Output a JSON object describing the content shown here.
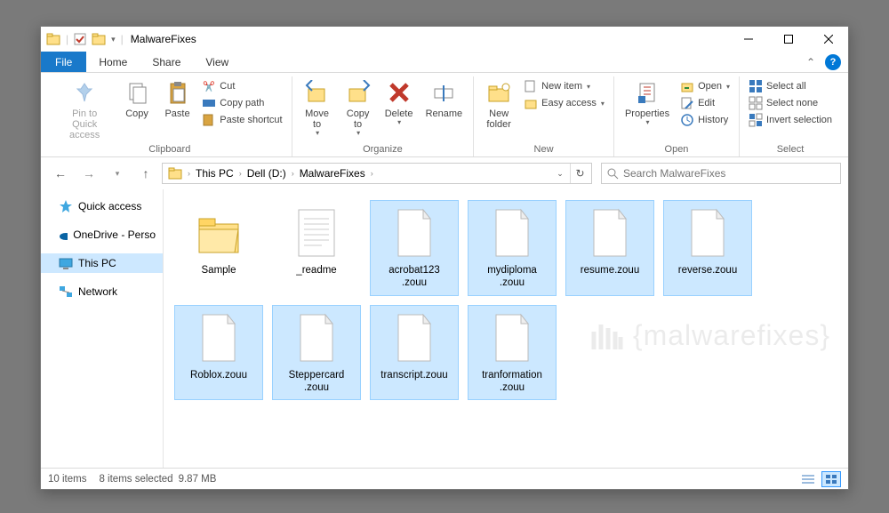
{
  "title": "MalwareFixes",
  "tabs": {
    "file": "File",
    "home": "Home",
    "share": "Share",
    "view": "View"
  },
  "ribbon": {
    "clipboard": {
      "label": "Clipboard",
      "pin": "Pin to Quick\naccess",
      "copy": "Copy",
      "paste": "Paste",
      "cut": "Cut",
      "copy_path": "Copy path",
      "paste_shortcut": "Paste shortcut"
    },
    "organize": {
      "label": "Organize",
      "move_to": "Move\nto",
      "copy_to": "Copy\nto",
      "delete": "Delete",
      "rename": "Rename"
    },
    "new": {
      "label": "New",
      "new_folder": "New\nfolder",
      "new_item": "New item",
      "easy_access": "Easy access"
    },
    "open": {
      "label": "Open",
      "properties": "Properties",
      "open": "Open",
      "edit": "Edit",
      "history": "History"
    },
    "select": {
      "label": "Select",
      "select_all": "Select all",
      "select_none": "Select none",
      "invert": "Invert selection"
    }
  },
  "breadcrumb": [
    "This PC",
    "Dell (D:)",
    "MalwareFixes"
  ],
  "search_placeholder": "Search MalwareFixes",
  "sidebar": {
    "quick_access": "Quick access",
    "onedrive": "OneDrive - Perso",
    "this_pc": "This PC",
    "network": "Network"
  },
  "files": [
    {
      "name": "Sample",
      "type": "folder",
      "selected": false
    },
    {
      "name": "_readme",
      "type": "text",
      "selected": false
    },
    {
      "name": "acrobat123\n.zouu",
      "type": "blank",
      "selected": true
    },
    {
      "name": "mydiploma\n.zouu",
      "type": "blank",
      "selected": true
    },
    {
      "name": "resume.zouu",
      "type": "blank",
      "selected": true
    },
    {
      "name": "reverse.zouu",
      "type": "blank",
      "selected": true
    },
    {
      "name": "Roblox.zouu",
      "type": "blank",
      "selected": true
    },
    {
      "name": "Steppercard\n.zouu",
      "type": "blank",
      "selected": true
    },
    {
      "name": "transcript.zouu",
      "type": "blank",
      "selected": true
    },
    {
      "name": "tranformation\n.zouu",
      "type": "blank",
      "selected": true
    }
  ],
  "watermark": "{malwarefixes}",
  "status": {
    "count": "10 items",
    "selected": "8 items selected",
    "size": "9.87 MB"
  }
}
